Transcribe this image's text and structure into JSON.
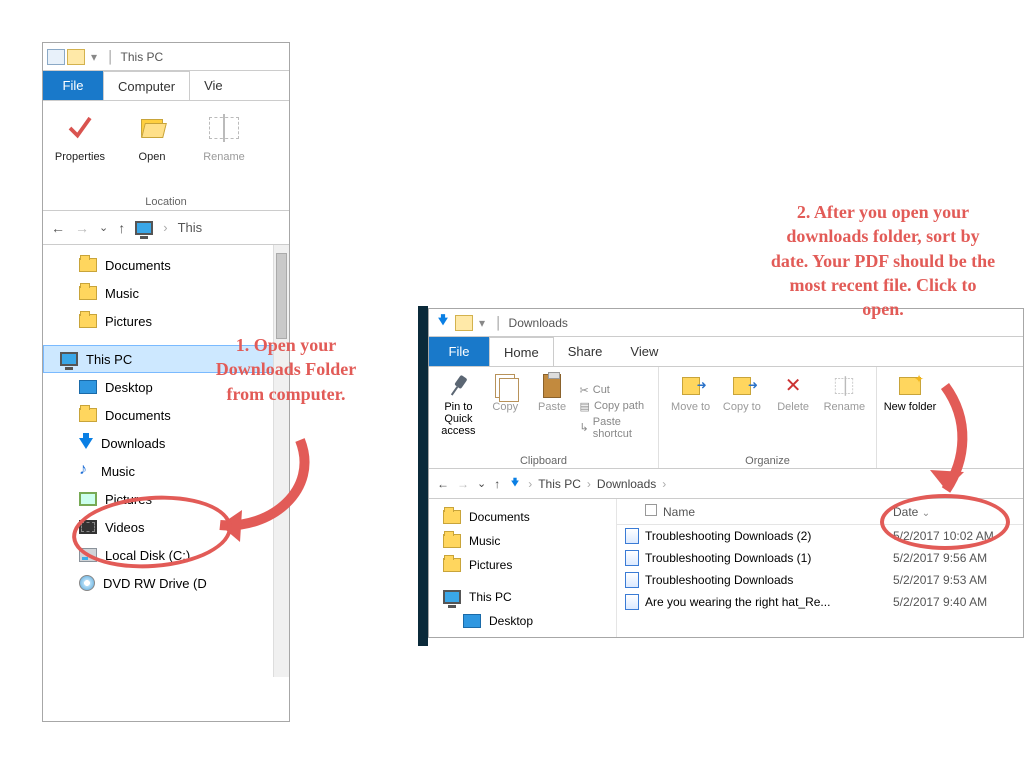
{
  "window1": {
    "title": "This PC",
    "tabs": {
      "file": "File",
      "computer": "Computer",
      "view": "Vie"
    },
    "ribbon": {
      "properties": "Properties",
      "open": "Open",
      "rename": "Rename",
      "group": "Location"
    },
    "breadcrumb": "This",
    "tree": {
      "documents": "Documents",
      "music": "Music",
      "pictures": "Pictures",
      "thispc": "This PC",
      "desktop": "Desktop",
      "documents2": "Documents",
      "downloads": "Downloads",
      "music2": "Music",
      "pictures2": "Pictures",
      "videos": "Videos",
      "localdisk": "Local Disk (C:)",
      "dvd": "DVD RW Drive (D"
    }
  },
  "window2": {
    "title": "Downloads",
    "tabs": {
      "file": "File",
      "home": "Home",
      "share": "Share",
      "view": "View"
    },
    "ribbon": {
      "pin": "Pin to Quick access",
      "copy": "Copy",
      "paste": "Paste",
      "cut": "Cut",
      "copypath": "Copy path",
      "pasteshortcut": "Paste shortcut",
      "clipboard_group": "Clipboard",
      "moveto": "Move to",
      "copyto": "Copy to",
      "delete": "Delete",
      "rename": "Rename",
      "organize_group": "Organize",
      "newfolder": "New folder"
    },
    "breadcrumb": {
      "a": "This PC",
      "b": "Downloads"
    },
    "nav": {
      "documents": "Documents",
      "music": "Music",
      "pictures": "Pictures",
      "thispc": "This PC",
      "desktop": "Desktop"
    },
    "columns": {
      "name": "Name",
      "date": "Date"
    },
    "rows": [
      {
        "name": "Troubleshooting Downloads (2)",
        "date": "5/2/2017 10:02 AM"
      },
      {
        "name": "Troubleshooting Downloads (1)",
        "date": "5/2/2017 9:56 AM"
      },
      {
        "name": "Troubleshooting Downloads",
        "date": "5/2/2017 9:53 AM"
      },
      {
        "name": "Are you wearing the right hat_Re...",
        "date": "5/2/2017 9:40 AM"
      }
    ]
  },
  "annotations": {
    "step1": "1. Open your Downloads Folder from computer.",
    "step2": "2. After you open your downloads folder, sort by date. Your PDF should be the most recent file.  Click to open."
  }
}
